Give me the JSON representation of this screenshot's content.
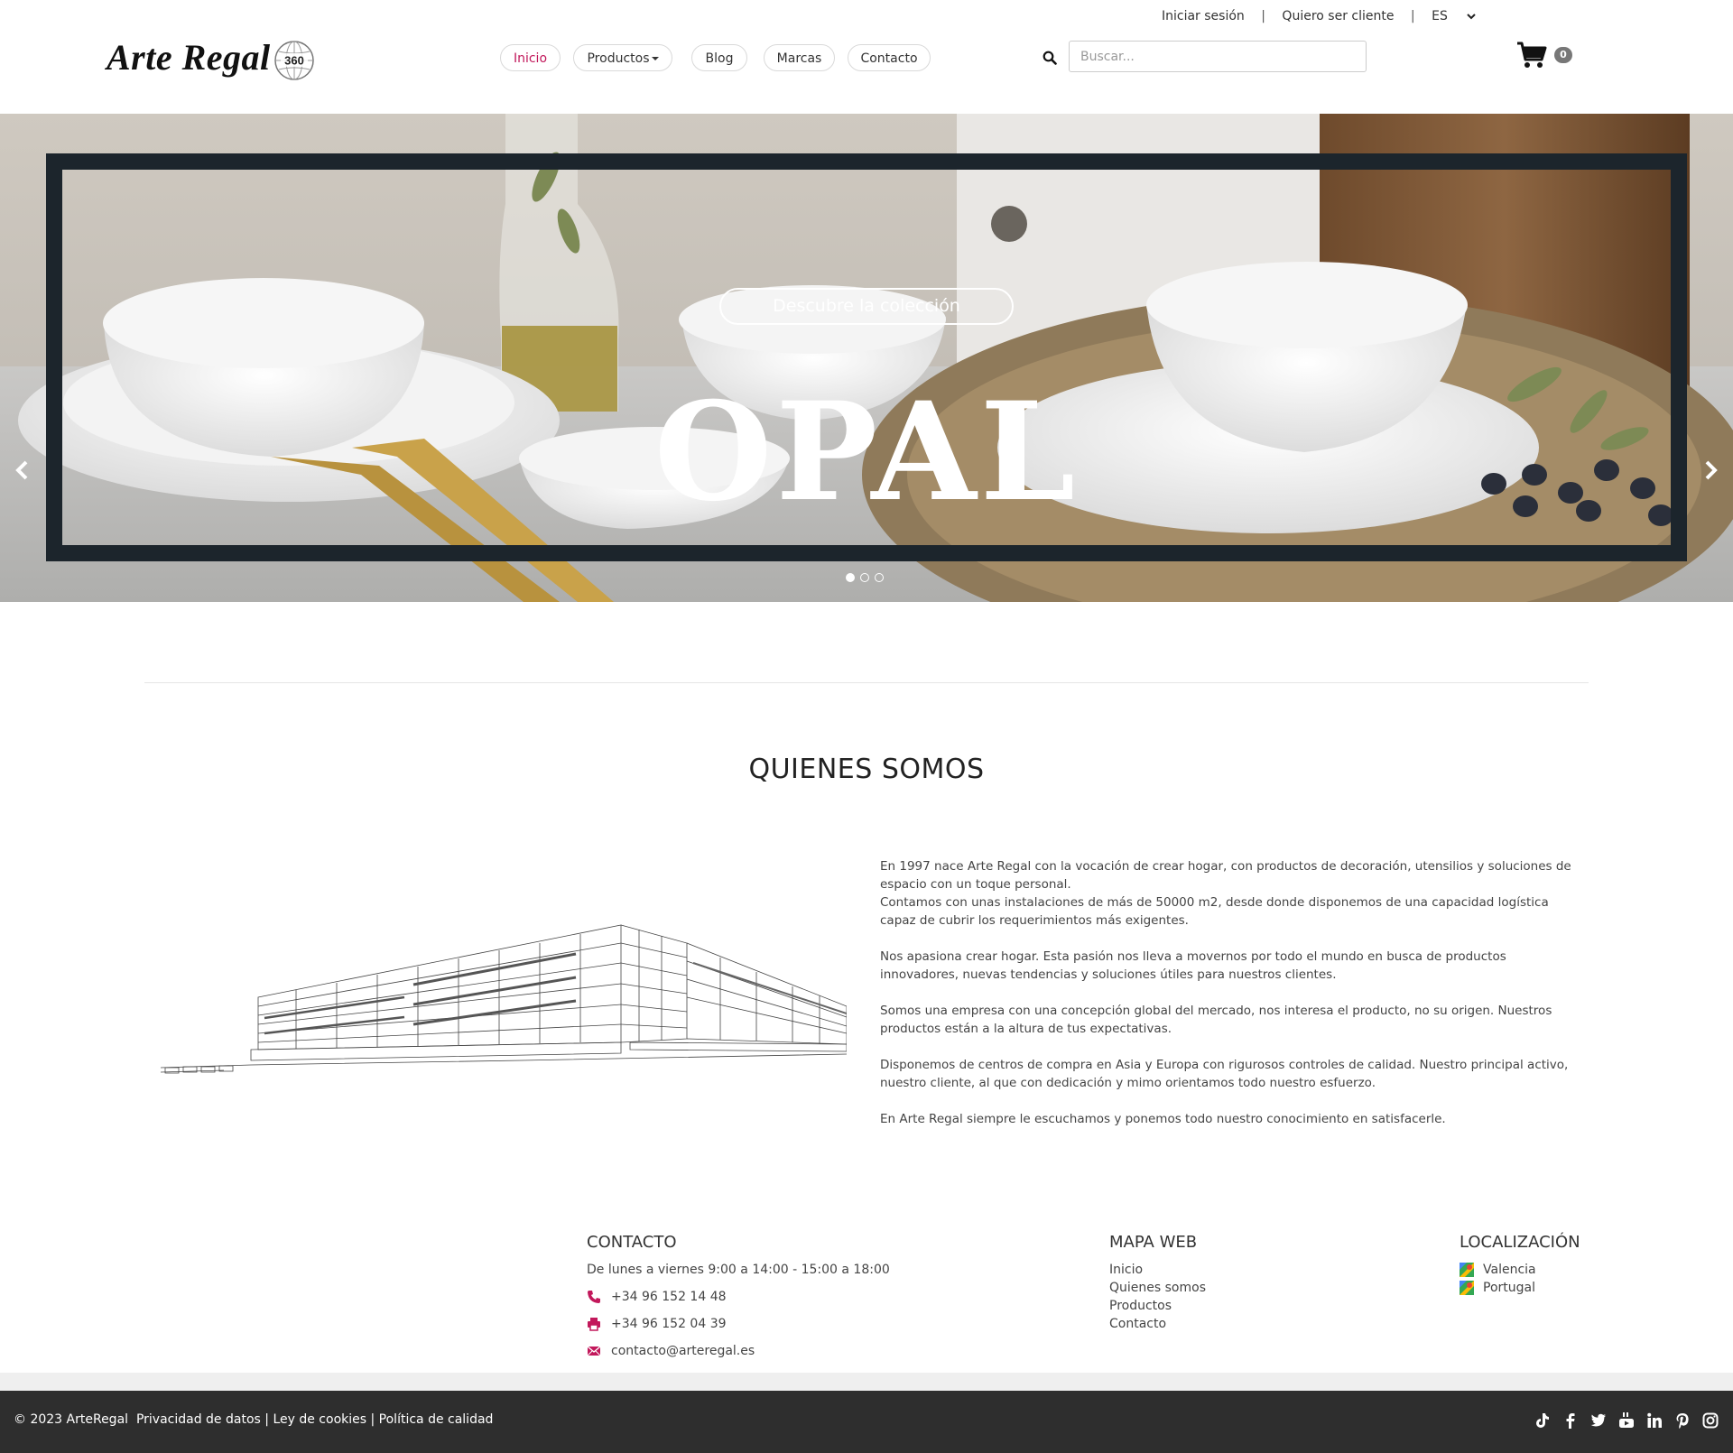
{
  "topbar": {
    "login": "Iniciar sesión",
    "register": "Quiero ser cliente",
    "language": "ES"
  },
  "logo": {
    "text": "Arte Regal",
    "badge": "360"
  },
  "nav": {
    "items": [
      {
        "label": "Inicio",
        "active": true
      },
      {
        "label": "Productos",
        "dropdown": true
      },
      {
        "label": "Blog"
      },
      {
        "label": "Marcas"
      },
      {
        "label": "Contacto"
      }
    ]
  },
  "search": {
    "placeholder": "Buscar..."
  },
  "cart": {
    "count": "0"
  },
  "hero": {
    "cta": "Descubre la colección",
    "title": "OPAL",
    "slides": 3,
    "active_slide": 1
  },
  "about": {
    "title": "QUIENES SOMOS",
    "paragraphs": [
      "En 1997 nace Arte Regal con la vocación de crear hogar, con productos de decoración, utensilios y soluciones de espacio con un toque personal.",
      "Contamos con unas instalaciones de más de 50000 m2, desde donde disponemos de una capacidad logística capaz de cubrir los requerimientos más exigentes.",
      "Nos apasiona crear hogar. Esta pasión nos lleva a movernos por todo el mundo en busca de productos innovadores, nuevas tendencias y soluciones útiles para nuestros clientes.",
      "Somos una empresa con una concepción global del mercado, nos interesa el producto, no su origen. Nuestros productos están a la altura de tus expectativas.",
      "Disponemos de centros de compra en Asia y Europa con rigurosos controles de calidad. Nuestro principal activo, nuestro cliente, al que con dedicación y mimo orientamos todo nuestro esfuerzo.",
      "En Arte Regal siempre le escuchamos y ponemos todo nuestro conocimiento en satisfacerle."
    ]
  },
  "footer": {
    "contact": {
      "title": "CONTACTO",
      "hours": "De lunes a viernes 9:00 a 14:00 - 15:00 a 18:00",
      "phone": "+34 96 152 14 48",
      "fax": "+34 96 152 04 39",
      "email": "contacto@arteregal.es"
    },
    "sitemap": {
      "title": "MAPA WEB",
      "links": [
        "Inicio",
        "Quienes somos",
        "Productos",
        "Contacto"
      ]
    },
    "location": {
      "title": "LOCALIZACIÓN",
      "places": [
        "Valencia",
        "Portugal"
      ]
    },
    "bottom": {
      "copyright": "© 2023 ArteRegal",
      "privacy": "Privacidad de datos",
      "cookies": "Ley de cookies",
      "quality": "Política de calidad"
    },
    "social": [
      "tiktok-icon",
      "facebook-icon",
      "twitter-icon",
      "youtube-icon",
      "linkedin-icon",
      "pinterest-icon",
      "instagram-icon"
    ]
  },
  "colors": {
    "accent": "#c2185b",
    "hero_frame": "#1c252c",
    "footer_bar": "#2e2e2e"
  }
}
